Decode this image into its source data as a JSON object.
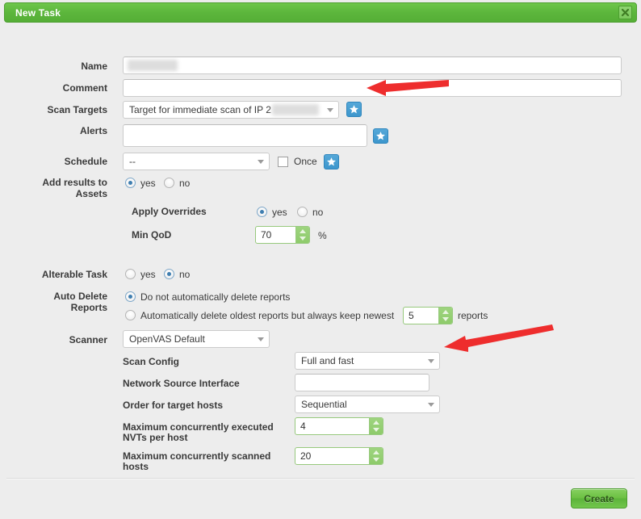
{
  "window": {
    "title": "New Task",
    "close_icon": "close-icon"
  },
  "fields": {
    "name": {
      "label": "Name",
      "value": "",
      "redacted": true
    },
    "comment": {
      "label": "Comment",
      "value": ""
    },
    "scan_targets": {
      "label": "Scan Targets",
      "value": "Target for immediate scan of IP 2",
      "value_suffix": "0",
      "new_icon": "star-icon"
    },
    "alerts": {
      "label": "Alerts",
      "value": "",
      "new_icon": "star-icon"
    },
    "schedule": {
      "label": "Schedule",
      "value": "--",
      "once_label": "Once",
      "once_checked": false,
      "new_icon": "star-icon"
    },
    "add_results": {
      "label": "Add results to Assets",
      "line1": "Add results to",
      "line2": "Assets",
      "yes_label": "yes",
      "no_label": "no",
      "selected": "yes"
    },
    "apply_overrides": {
      "label": "Apply Overrides",
      "yes_label": "yes",
      "no_label": "no",
      "selected": "yes"
    },
    "min_qod": {
      "label": "Min QoD",
      "value": "70",
      "unit": "%"
    },
    "alterable_task": {
      "label": "Alterable Task",
      "yes_label": "yes",
      "no_label": "no",
      "selected": "no"
    },
    "auto_delete": {
      "label": "Auto Delete Reports",
      "line1": "Auto Delete",
      "line2": "Reports",
      "option1": "Do not automatically delete reports",
      "option2": "Automatically delete oldest reports but always keep newest",
      "option2_suffix": "reports",
      "keep_value": "5",
      "selected": "option1"
    },
    "scanner": {
      "label": "Scanner",
      "value": "OpenVAS Default"
    },
    "scan_config": {
      "label": "Scan Config",
      "value": "Full and fast"
    },
    "network_source_interface": {
      "label": "Network Source Interface",
      "value": ""
    },
    "order_target_hosts": {
      "label": "Order for target hosts",
      "value": "Sequential"
    },
    "max_nvts": {
      "label": "Maximum concurrently executed NVTs per host",
      "line1": "Maximum concurrently executed",
      "line2": "NVTs per host",
      "value": "4"
    },
    "max_hosts": {
      "label": "Maximum concurrently scanned hosts",
      "line1": "Maximum concurrently scanned",
      "line2": "hosts",
      "value": "20"
    }
  },
  "footer": {
    "create_label": "Create"
  },
  "annotations": [
    {
      "name": "arrow-scan-targets",
      "color": "#ee2d2d"
    },
    {
      "name": "arrow-scan-config",
      "color": "#ee2d2d"
    }
  ],
  "colors": {
    "title_green": "#5cb63c",
    "accent_blue": "#3d97cd",
    "annotation_red": "#ee2d2d",
    "dialog_bg": "#ededed"
  }
}
